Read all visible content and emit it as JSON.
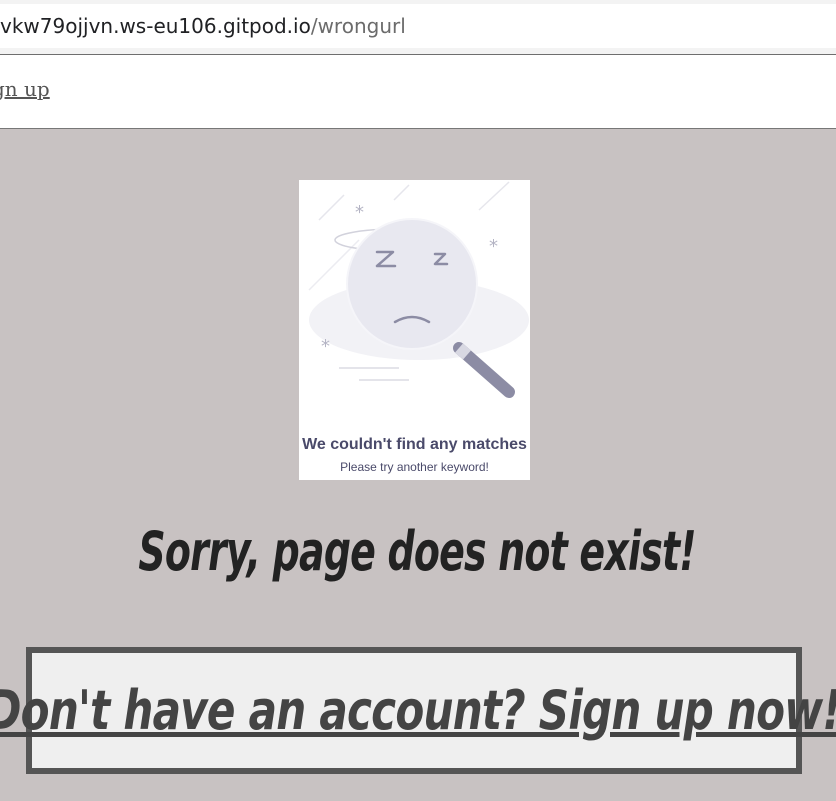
{
  "browser": {
    "url_host": "vkw79ojjvn.ws-eu106.gitpod.io",
    "url_path": "/wrongurl"
  },
  "nav": {
    "signup_link": "gn up"
  },
  "illustration": {
    "title": "We couldn't find any matches",
    "subtitle": "Please try another keyword!"
  },
  "main": {
    "message": "Sorry, page does not exist!",
    "cta": "Don't have an account? Sign up now!"
  },
  "colors": {
    "background": "#c8c2c2",
    "cta_border": "#555555"
  }
}
